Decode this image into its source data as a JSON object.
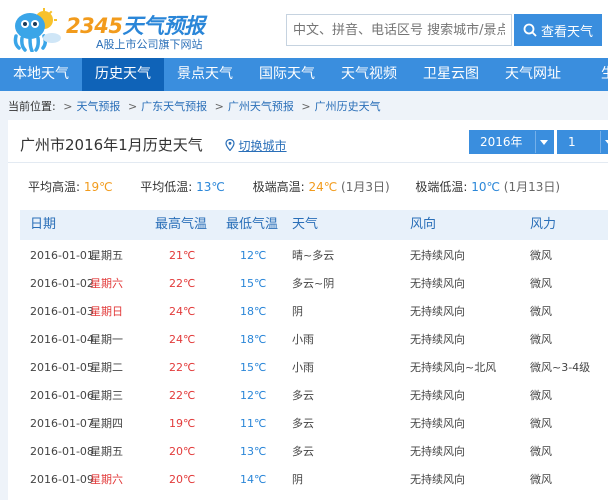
{
  "header": {
    "brand_prefix": "2345",
    "brand_suffix": "天气预报",
    "slogan": "A股上市公司旗下网站",
    "search_placeholder": "中文、拼音、电话区号 搜索城市/景点",
    "search_button": "查看天气"
  },
  "nav": {
    "items": [
      "本地天气",
      "历史天气",
      "景点天气",
      "国际天气",
      "天气视频",
      "卫星云图",
      "天气网址",
      "生活"
    ],
    "active_index": 1
  },
  "breadcrumb": {
    "prefix": "当前位置:",
    "items": [
      "天气预报",
      "广东天气预报",
      "广州天气预报",
      "广州历史天气"
    ]
  },
  "panel": {
    "title": "广州市2016年1月历史天气",
    "switch_city": "切换城市",
    "year_select": "2016年",
    "month_select": "1月"
  },
  "stats": {
    "avg_high_label": "平均高温:",
    "avg_high": "19℃",
    "avg_low_label": "平均低温:",
    "avg_low": "13℃",
    "max_high_label": "极端高温:",
    "max_high": "24℃",
    "max_high_date": "(1月3日)",
    "min_low_label": "极端低温:",
    "min_low": "10℃",
    "min_low_date": "(1月13日)"
  },
  "table": {
    "headers": [
      "日期",
      "最高气温",
      "最低气温",
      "天气",
      "风向",
      "风力"
    ],
    "rows": [
      {
        "date": "2016-01-01",
        "weekday": "星期五",
        "weekend": false,
        "high": "21℃",
        "low": "12℃",
        "weather": "晴~多云",
        "wind_dir": "无持续风向",
        "wind_power": "微风"
      },
      {
        "date": "2016-01-02",
        "weekday": "星期六",
        "weekend": true,
        "high": "22℃",
        "low": "15℃",
        "weather": "多云~阴",
        "wind_dir": "无持续风向",
        "wind_power": "微风"
      },
      {
        "date": "2016-01-03",
        "weekday": "星期日",
        "weekend": true,
        "high": "24℃",
        "low": "18℃",
        "weather": "阴",
        "wind_dir": "无持续风向",
        "wind_power": "微风"
      },
      {
        "date": "2016-01-04",
        "weekday": "星期一",
        "weekend": false,
        "high": "24℃",
        "low": "18℃",
        "weather": "小雨",
        "wind_dir": "无持续风向",
        "wind_power": "微风"
      },
      {
        "date": "2016-01-05",
        "weekday": "星期二",
        "weekend": false,
        "high": "22℃",
        "low": "15℃",
        "weather": "小雨",
        "wind_dir": "无持续风向~北风",
        "wind_power": "微风~3-4级"
      },
      {
        "date": "2016-01-06",
        "weekday": "星期三",
        "weekend": false,
        "high": "22℃",
        "low": "12℃",
        "weather": "多云",
        "wind_dir": "无持续风向",
        "wind_power": "微风"
      },
      {
        "date": "2016-01-07",
        "weekday": "星期四",
        "weekend": false,
        "high": "19℃",
        "low": "11℃",
        "weather": "多云",
        "wind_dir": "无持续风向",
        "wind_power": "微风"
      },
      {
        "date": "2016-01-08",
        "weekday": "星期五",
        "weekend": false,
        "high": "20℃",
        "low": "13℃",
        "weather": "多云",
        "wind_dir": "无持续风向",
        "wind_power": "微风"
      },
      {
        "date": "2016-01-09",
        "weekday": "星期六",
        "weekend": true,
        "high": "20℃",
        "low": "14℃",
        "weather": "阴",
        "wind_dir": "无持续风向",
        "wind_power": "微风"
      }
    ]
  },
  "colors": {
    "primary": "#3a8ede",
    "nav_active": "#0f63b8",
    "link": "#2a6fb8",
    "high_temp": "#e23a3a",
    "low_temp": "#2a86d8",
    "stat_hot": "#f29b1c"
  }
}
